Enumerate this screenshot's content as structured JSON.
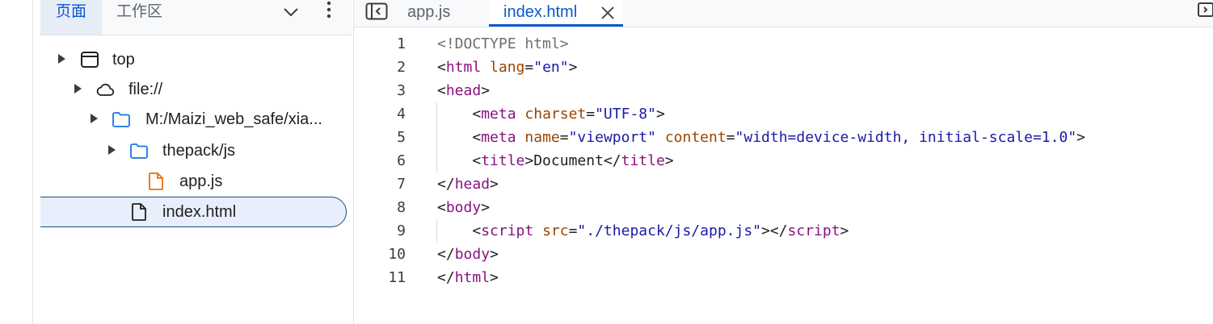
{
  "nav_panel": {
    "tabs": [
      {
        "label": "页面",
        "active": true
      },
      {
        "label": "工作区",
        "active": false
      }
    ],
    "tree": [
      {
        "label": "top",
        "icon": "frame-icon",
        "depth": 0,
        "expandable": true
      },
      {
        "label": "file://",
        "icon": "cloud-icon",
        "depth": 1,
        "expandable": true
      },
      {
        "label": "M:/Maizi_web_safe/xia...",
        "icon": "folder-icon",
        "depth": 2,
        "expandable": true
      },
      {
        "label": "thepack/js",
        "icon": "folder-icon",
        "depth": 3,
        "expandable": true
      },
      {
        "label": "app.js",
        "icon": "js-file-icon",
        "depth": 4,
        "expandable": false
      },
      {
        "label": "index.html",
        "icon": "file-icon",
        "depth": 3,
        "expandable": false,
        "selected": true
      }
    ]
  },
  "editor": {
    "tabs": [
      {
        "label": "app.js",
        "active": false
      },
      {
        "label": "index.html",
        "active": true
      }
    ],
    "lines": [
      {
        "n": "1",
        "tokens": [
          [
            "doctype",
            "<!DOCTYPE html>"
          ]
        ]
      },
      {
        "n": "2",
        "tokens": [
          [
            "punc",
            "<"
          ],
          [
            "tag",
            "html"
          ],
          [
            "punc",
            " "
          ],
          [
            "attr",
            "lang"
          ],
          [
            "punc",
            "="
          ],
          [
            "val",
            "\"en\""
          ],
          [
            "punc",
            ">"
          ]
        ]
      },
      {
        "n": "3",
        "tokens": [
          [
            "punc",
            "<"
          ],
          [
            "tag",
            "head"
          ],
          [
            "punc",
            ">"
          ]
        ]
      },
      {
        "n": "4",
        "tokens": [
          [
            "punc",
            "    <"
          ],
          [
            "tag",
            "meta"
          ],
          [
            "punc",
            " "
          ],
          [
            "attr",
            "charset"
          ],
          [
            "punc",
            "="
          ],
          [
            "val",
            "\"UTF-8\""
          ],
          [
            "punc",
            ">"
          ]
        ]
      },
      {
        "n": "5",
        "tokens": [
          [
            "punc",
            "    <"
          ],
          [
            "tag",
            "meta"
          ],
          [
            "punc",
            " "
          ],
          [
            "attr",
            "name"
          ],
          [
            "punc",
            "="
          ],
          [
            "val",
            "\"viewport\""
          ],
          [
            "punc",
            " "
          ],
          [
            "attr",
            "content"
          ],
          [
            "punc",
            "="
          ],
          [
            "val",
            "\"width=device-width, initial-scale=1.0\""
          ],
          [
            "punc",
            ">"
          ]
        ]
      },
      {
        "n": "6",
        "tokens": [
          [
            "punc",
            "    <"
          ],
          [
            "tag",
            "title"
          ],
          [
            "punc",
            ">"
          ],
          [
            "text",
            "Document"
          ],
          [
            "punc",
            "</"
          ],
          [
            "tag",
            "title"
          ],
          [
            "punc",
            ">"
          ]
        ]
      },
      {
        "n": "7",
        "tokens": [
          [
            "punc",
            "</"
          ],
          [
            "tag",
            "head"
          ],
          [
            "punc",
            ">"
          ]
        ]
      },
      {
        "n": "8",
        "tokens": [
          [
            "punc",
            "<"
          ],
          [
            "tag",
            "body"
          ],
          [
            "punc",
            ">"
          ]
        ]
      },
      {
        "n": "9",
        "tokens": [
          [
            "punc",
            "    <"
          ],
          [
            "tag",
            "script"
          ],
          [
            "punc",
            " "
          ],
          [
            "attr",
            "src"
          ],
          [
            "punc",
            "="
          ],
          [
            "val",
            "\"./thepack/js/app.js\""
          ],
          [
            "punc",
            "></"
          ],
          [
            "tag",
            "script"
          ],
          [
            "punc",
            ">"
          ]
        ]
      },
      {
        "n": "10",
        "tokens": [
          [
            "punc",
            "</"
          ],
          [
            "tag",
            "body"
          ],
          [
            "punc",
            ">"
          ]
        ]
      },
      {
        "n": "11",
        "tokens": [
          [
            "punc",
            "</"
          ],
          [
            "tag",
            "html"
          ],
          [
            "punc",
            ">"
          ]
        ]
      }
    ]
  },
  "colors": {
    "accent": "#0b57d0",
    "tag": "#881280",
    "attr": "#994500",
    "value": "#1a1aa6",
    "js_icon": "#e8710a",
    "folder_icon": "#1a73e8"
  }
}
